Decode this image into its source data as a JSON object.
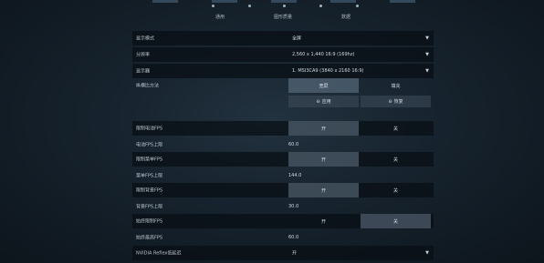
{
  "tabs": [
    "通用",
    "图形质量",
    "数据"
  ],
  "settings": {
    "display_mode": {
      "label": "显示模式",
      "value": "全屏"
    },
    "resolution": {
      "label": "分辨率",
      "value": "2,560 x 1,440 16:9 (169hz)"
    },
    "monitor": {
      "label": "显示器",
      "value": "1. MSI3CA9 (3840 x 2160 16:9)"
    },
    "aspect": {
      "label": "纵横比方法",
      "option_a": "宽屏",
      "option_b": "填充"
    },
    "actions": {
      "apply": "应用",
      "restore": "恢复"
    },
    "limit_battery_fps": {
      "label": "限制电池FPS",
      "on": "开",
      "off": "关"
    },
    "battery_fps_cap": {
      "label": "电池FPS上限",
      "value": "60.0"
    },
    "limit_menu_fps": {
      "label": "限制菜单FPS",
      "on": "开",
      "off": "关"
    },
    "menu_fps_cap": {
      "label": "菜单FPS上限",
      "value": "144.0"
    },
    "limit_bg_fps": {
      "label": "限制背景FPS",
      "on": "开",
      "off": "关"
    },
    "bg_fps_cap": {
      "label": "背景FPS上限",
      "value": "30.0"
    },
    "limit_any_fps": {
      "label": "始终限制FPS",
      "on": "开",
      "off": "关"
    },
    "max_fps": {
      "label": "始终最高FPS",
      "value": "60.0"
    },
    "reflex": {
      "label": "NVIDIA Reflex低延迟",
      "value": "开"
    }
  },
  "icons": {
    "dropdown": "chevron-down-icon",
    "apply": "apply-icon",
    "restore": "restore-icon"
  }
}
